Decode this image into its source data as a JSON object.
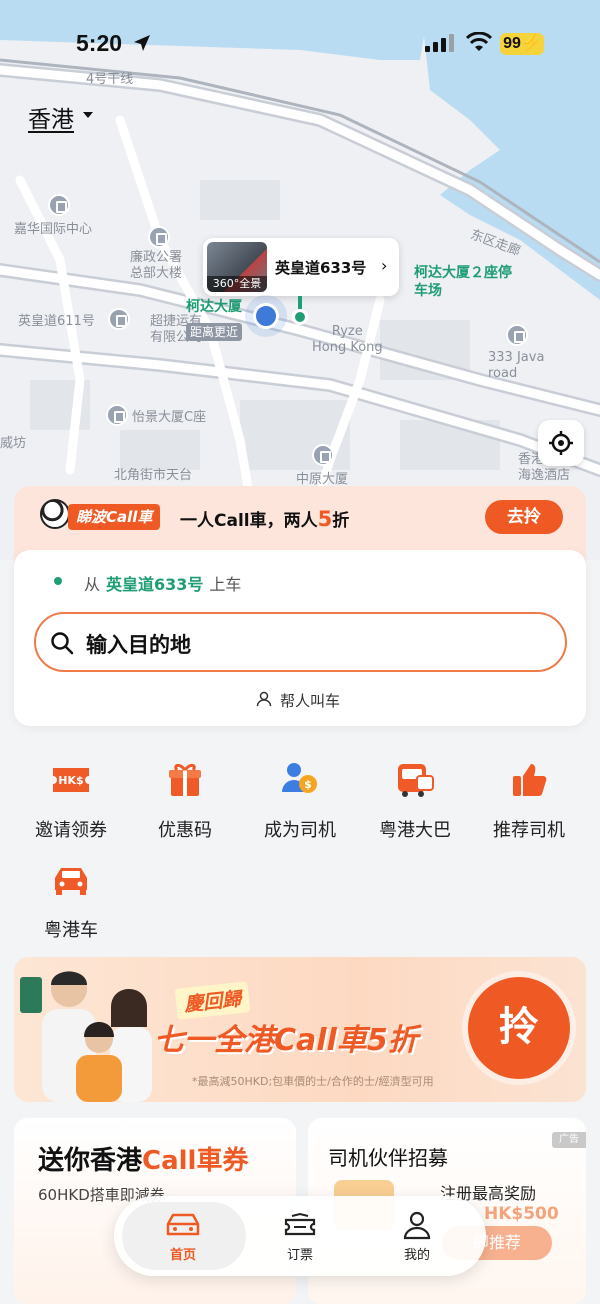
{
  "status_bar": {
    "time": "5:20",
    "battery": "99"
  },
  "map": {
    "city": "香港",
    "labels": {
      "road_4": "4号干线",
      "east_corridor": "东区走廊",
      "harbour_centre": "嘉华国际中心",
      "icac": "廉政公署\n总部大楼",
      "queens_611": "英皇道611号",
      "chiu_tat": "超捷运有\n有限公司",
      "kodak_house": "柯达大厦",
      "kodak_2": "柯达大厦２座停\n车场",
      "ryze": "Ryze\nHong Kong",
      "java_333": "333 Java\nroad",
      "yee_wah": "怡景大厦C座",
      "north_point": "北角街市天台",
      "central": "中原大厦",
      "harbour_hotel": "香港\n海逸酒店",
      "wai_fong": "威坊"
    },
    "pickup_thumb_label": "360°全景",
    "pickup_name": "英皇道633号",
    "near_tag": "距离更近"
  },
  "promo": {
    "badge": "睇波Call車",
    "text_prefix": "一人Call車，两人",
    "text_highlight": "5",
    "text_suffix": "折",
    "button": "去拎"
  },
  "booking": {
    "from_prefix": "从",
    "from_place": "英皇道633号",
    "from_suffix": "上车",
    "destination_placeholder": "输入目的地",
    "help_call": "帮人叫车"
  },
  "shortcuts": [
    {
      "label": "邀请领券",
      "icon": "coupon-hkd-icon"
    },
    {
      "label": "优惠码",
      "icon": "gift-icon"
    },
    {
      "label": "成为司机",
      "icon": "driver-earn-icon"
    },
    {
      "label": "粤港大巴",
      "icon": "bus-icon"
    },
    {
      "label": "推荐司机",
      "icon": "thumbs-up-icon"
    },
    {
      "label": "粤港车",
      "icon": "car-icon"
    }
  ],
  "banner": {
    "tag": "慶回歸",
    "title": "七一全港Call車5折",
    "fine_print": "*最高減50HKD;包車價的士/合作的士/經濟型可用",
    "button": "拎"
  },
  "cards": {
    "left": {
      "title_prefix": "送你香港",
      "title_highlight": "Call車券",
      "subtitle": "60HKD搭車即減券"
    },
    "right": {
      "title": "司机伙伴招募",
      "ad": "广告",
      "line1": "注册最高奖励",
      "line2": "HK$500",
      "button": "即推荐"
    }
  },
  "tabbar": {
    "home": "首页",
    "tickets": "订票",
    "mine": "我的"
  },
  "colors": {
    "accent": "#ef5a24",
    "green": "#1f9d74"
  }
}
